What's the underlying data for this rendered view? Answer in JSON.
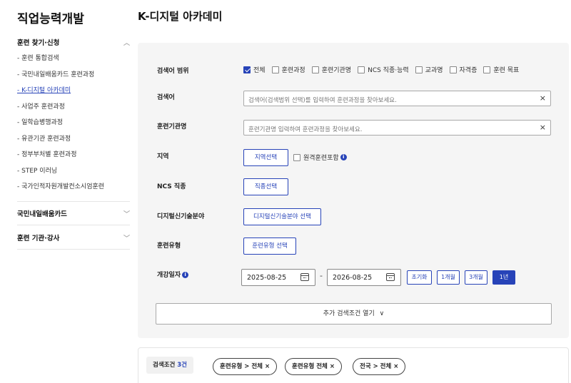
{
  "sidebar": {
    "title": "직업능력개발",
    "sections": [
      {
        "label": "훈련 찾기·신청",
        "expanded": true,
        "items": [
          {
            "label": "- 훈련 통합검색"
          },
          {
            "label": "- 국민내일배움카드 훈련과정"
          },
          {
            "label": "- K-디지털 아카데미"
          },
          {
            "label": "- 사업주 훈련과정"
          },
          {
            "label": "- 일학습병행과정"
          },
          {
            "label": "- 유관기관 훈련과정"
          },
          {
            "label": "- 정부부처별 훈련과정"
          },
          {
            "label": "- STEP 이러닝"
          },
          {
            "label": "- 국가인적자원개발컨소시엄훈련"
          }
        ]
      },
      {
        "label": "국민내일배움카드",
        "expanded": false
      },
      {
        "label": "훈련 기관·강사",
        "expanded": false
      }
    ]
  },
  "page": {
    "title": "K-디지털 아카데미"
  },
  "search": {
    "scope_label": "검색어 범위",
    "scope_options": [
      {
        "label": "전체",
        "checked": true
      },
      {
        "label": "훈련과정",
        "checked": false
      },
      {
        "label": "훈련기관명",
        "checked": false
      },
      {
        "label": "NCS 직종·능력",
        "checked": false
      },
      {
        "label": "교과명",
        "checked": false
      },
      {
        "label": "자격증",
        "checked": false
      },
      {
        "label": "훈련 목표",
        "checked": false
      }
    ],
    "keyword_label": "검색어",
    "keyword_placeholder": "검색어(검색범위 선택)를 입력하여 훈련과정을 찾아보세요.",
    "institution_label": "훈련기관명",
    "institution_placeholder": "훈련기관명 입력하여 훈련과정을 찾아보세요.",
    "region_label": "지역",
    "region_button": "지역선택",
    "remote_label": "원격훈련포함",
    "ncs_label": "NCS 직종",
    "ncs_button": "직종선택",
    "digital_label": "디지털신기술분야",
    "digital_button": "디지털신기술분야 선택",
    "type_label": "훈련유형",
    "type_button": "훈련유형 선택",
    "date_label": "개강일자",
    "date_start": "2025-08-25",
    "date_end": "2026-08-25",
    "date_separator": "-",
    "date_chips": [
      {
        "label": "초기화",
        "active": false
      },
      {
        "label": "1개월",
        "active": false
      },
      {
        "label": "3개월",
        "active": false
      },
      {
        "label": "1년",
        "active": true
      }
    ],
    "more_label": "추가 검색조건 열기"
  },
  "conditions": {
    "label": "검색조건",
    "count": "3건",
    "tags": [
      {
        "label": "훈련유형 > 전체"
      },
      {
        "label": "훈련유형 전체"
      },
      {
        "label": "전국 > 전체"
      }
    ]
  },
  "colors": {
    "accent": "#2743b8",
    "panel_bg": "#f5f5f5"
  }
}
